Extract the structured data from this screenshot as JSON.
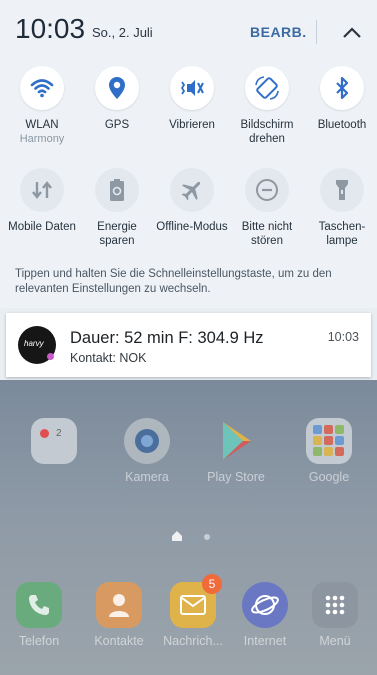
{
  "header": {
    "time": "10:03",
    "date": "So., 2. Juli",
    "edit_label": "BEARB."
  },
  "quick_settings": {
    "row1": [
      {
        "label": "WLAN",
        "sublabel": "Harmony",
        "icon": "wifi-icon",
        "state": "on"
      },
      {
        "label": "GPS",
        "sublabel": "",
        "icon": "location-pin-icon",
        "state": "on"
      },
      {
        "label": "Vibrieren",
        "sublabel": "",
        "icon": "vibrate-icon",
        "state": "on"
      },
      {
        "label": "Bildschirm drehen",
        "sublabel": "",
        "icon": "rotate-screen-icon",
        "state": "on"
      },
      {
        "label": "Bluetooth",
        "sublabel": "",
        "icon": "bluetooth-icon",
        "state": "on"
      }
    ],
    "row2": [
      {
        "label": "Mobile Daten",
        "icon": "mobile-data-icon",
        "state": "off"
      },
      {
        "label": "Energie sparen",
        "icon": "battery-saver-icon",
        "state": "off"
      },
      {
        "label": "Offline-Modus",
        "icon": "airplane-icon",
        "state": "off"
      },
      {
        "label": "Bitte nicht stören",
        "icon": "do-not-disturb-icon",
        "state": "off"
      },
      {
        "label": "Taschen-lampe",
        "icon": "flashlight-icon",
        "state": "off"
      }
    ],
    "hint": "Tippen und halten Sie die Schnelleinstellungstaste, um zu den relevanten Einstellungen zu wechseln."
  },
  "notification": {
    "app_icon_text": "harvy",
    "title": "Dauer: 52 min F: 304.9 Hz",
    "text": "Kontakt: NOK",
    "time": "10:03"
  },
  "home": {
    "row1": [
      {
        "name": "",
        "icon": "folder-icon"
      },
      {
        "name": "Kamera",
        "icon": "camera-icon"
      },
      {
        "name": "Play Store",
        "icon": "play-store-icon"
      },
      {
        "name": "Google",
        "icon": "google-folder-icon"
      }
    ],
    "dock": [
      {
        "name": "Telefon",
        "icon": "phone-icon",
        "badge": ""
      },
      {
        "name": "Kontakte",
        "icon": "contacts-icon",
        "badge": ""
      },
      {
        "name": "Nachrich...",
        "icon": "messages-icon",
        "badge": "5"
      },
      {
        "name": "Internet",
        "icon": "internet-icon",
        "badge": ""
      },
      {
        "name": "Menü",
        "icon": "apps-menu-icon",
        "badge": ""
      }
    ]
  },
  "colors": {
    "accent_blue": "#2f6fc7",
    "panel_bg": "#eef2f7",
    "tile_off_icon": "#8d98a3"
  }
}
